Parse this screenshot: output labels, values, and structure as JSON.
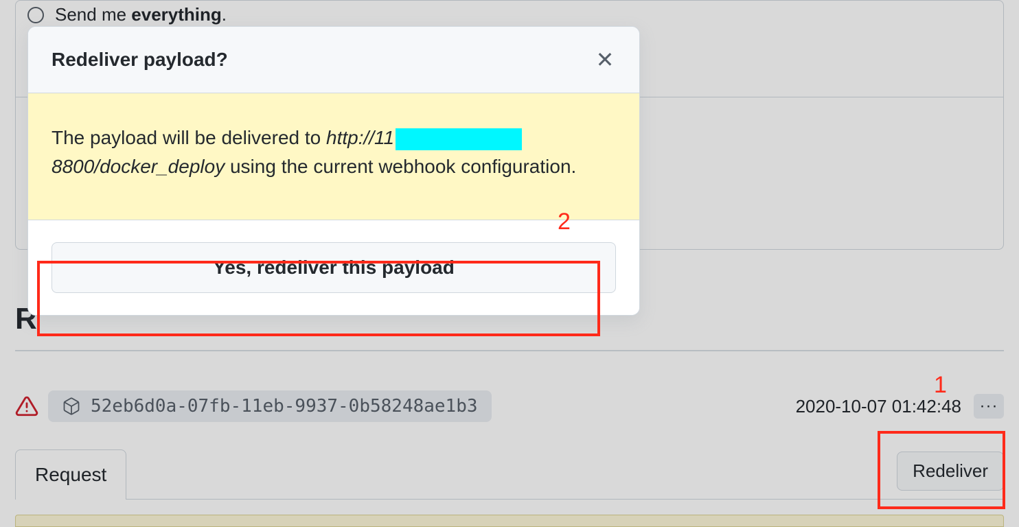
{
  "bg": {
    "option_text_prefix": "Send me ",
    "option_text_bold": "everything",
    "option_text_suffix": ".",
    "section_heading": "R",
    "delivery_id": "52eb6d0a-07fb-11eb-9937-0b58248ae1b3",
    "delivery_time": "2020-10-07 01:42:48",
    "more_glyph": "···",
    "tab_label": "Request",
    "redeliver_button": "Redeliver"
  },
  "modal": {
    "title": "Redeliver payload?",
    "close_glyph": "✕",
    "body_prefix": "The payload will be delivered to ",
    "url_before": "http://11",
    "url_after": "8800/docker_deploy",
    "body_suffix": " using the current webhook configuration.",
    "confirm_button": "Yes, redeliver this payload"
  },
  "annotations": {
    "label1": "1",
    "label2": "2"
  }
}
